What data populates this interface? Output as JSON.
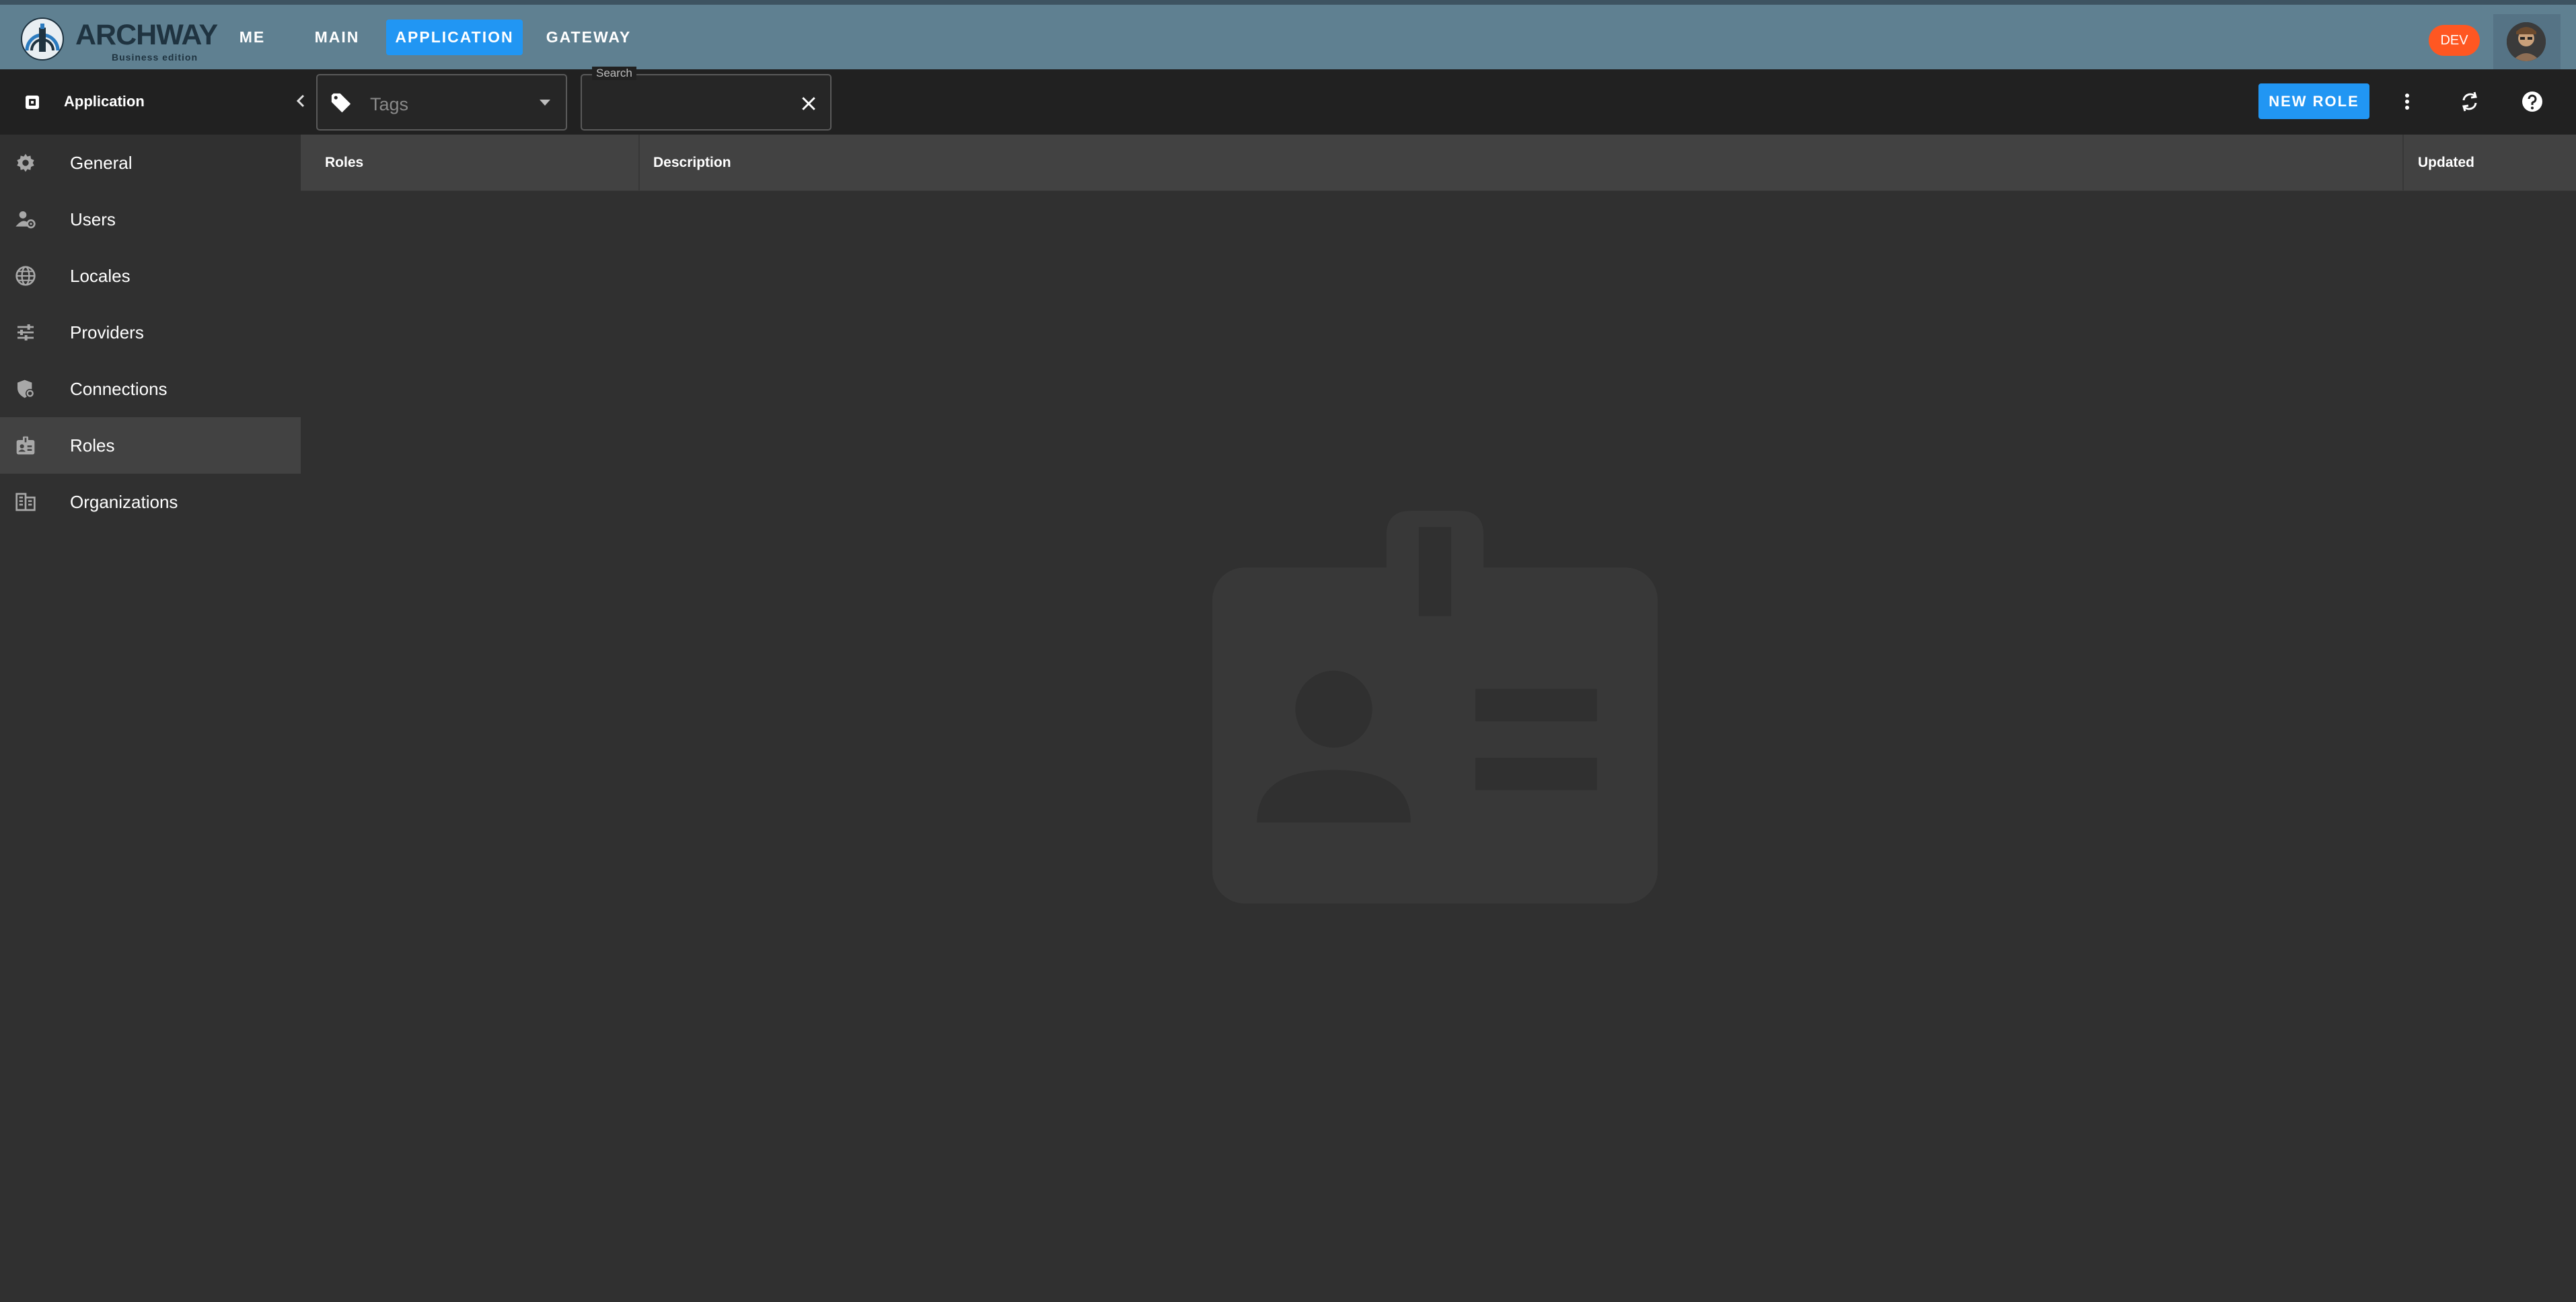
{
  "brand": {
    "name": "ARCHWAY",
    "subtitle": "Business edition"
  },
  "topnav": {
    "items": [
      {
        "label": "ME",
        "active": false
      },
      {
        "label": "MAIN",
        "active": false
      },
      {
        "label": "APPLICATION",
        "active": true
      },
      {
        "label": "GATEWAY",
        "active": false
      }
    ]
  },
  "environment_badge": "DEV",
  "app_header": {
    "title": "Application"
  },
  "filters": {
    "tags_placeholder": "Tags",
    "search_label": "Search",
    "search_value": ""
  },
  "toolbar": {
    "new_role_label": "NEW ROLE",
    "icons": [
      "more-vert-icon",
      "refresh-icon",
      "help-icon"
    ]
  },
  "sidebar": {
    "items": [
      {
        "label": "General",
        "icon": "gear-icon",
        "active": false
      },
      {
        "label": "Users",
        "icon": "users-settings-icon",
        "active": false
      },
      {
        "label": "Locales",
        "icon": "globe-icon",
        "active": false
      },
      {
        "label": "Providers",
        "icon": "sliders-icon",
        "active": false
      },
      {
        "label": "Connections",
        "icon": "shield-gear-icon",
        "active": false
      },
      {
        "label": "Roles",
        "icon": "badge-icon",
        "active": true
      },
      {
        "label": "Organizations",
        "icon": "building-icon",
        "active": false
      }
    ]
  },
  "table": {
    "columns": [
      "Roles",
      "Description",
      "Updated"
    ],
    "rows": []
  },
  "colors": {
    "topbar": "#5f8091",
    "accent": "#2196f3",
    "badge": "#ff5722",
    "surface": "#303030",
    "toolbar": "#212121"
  }
}
